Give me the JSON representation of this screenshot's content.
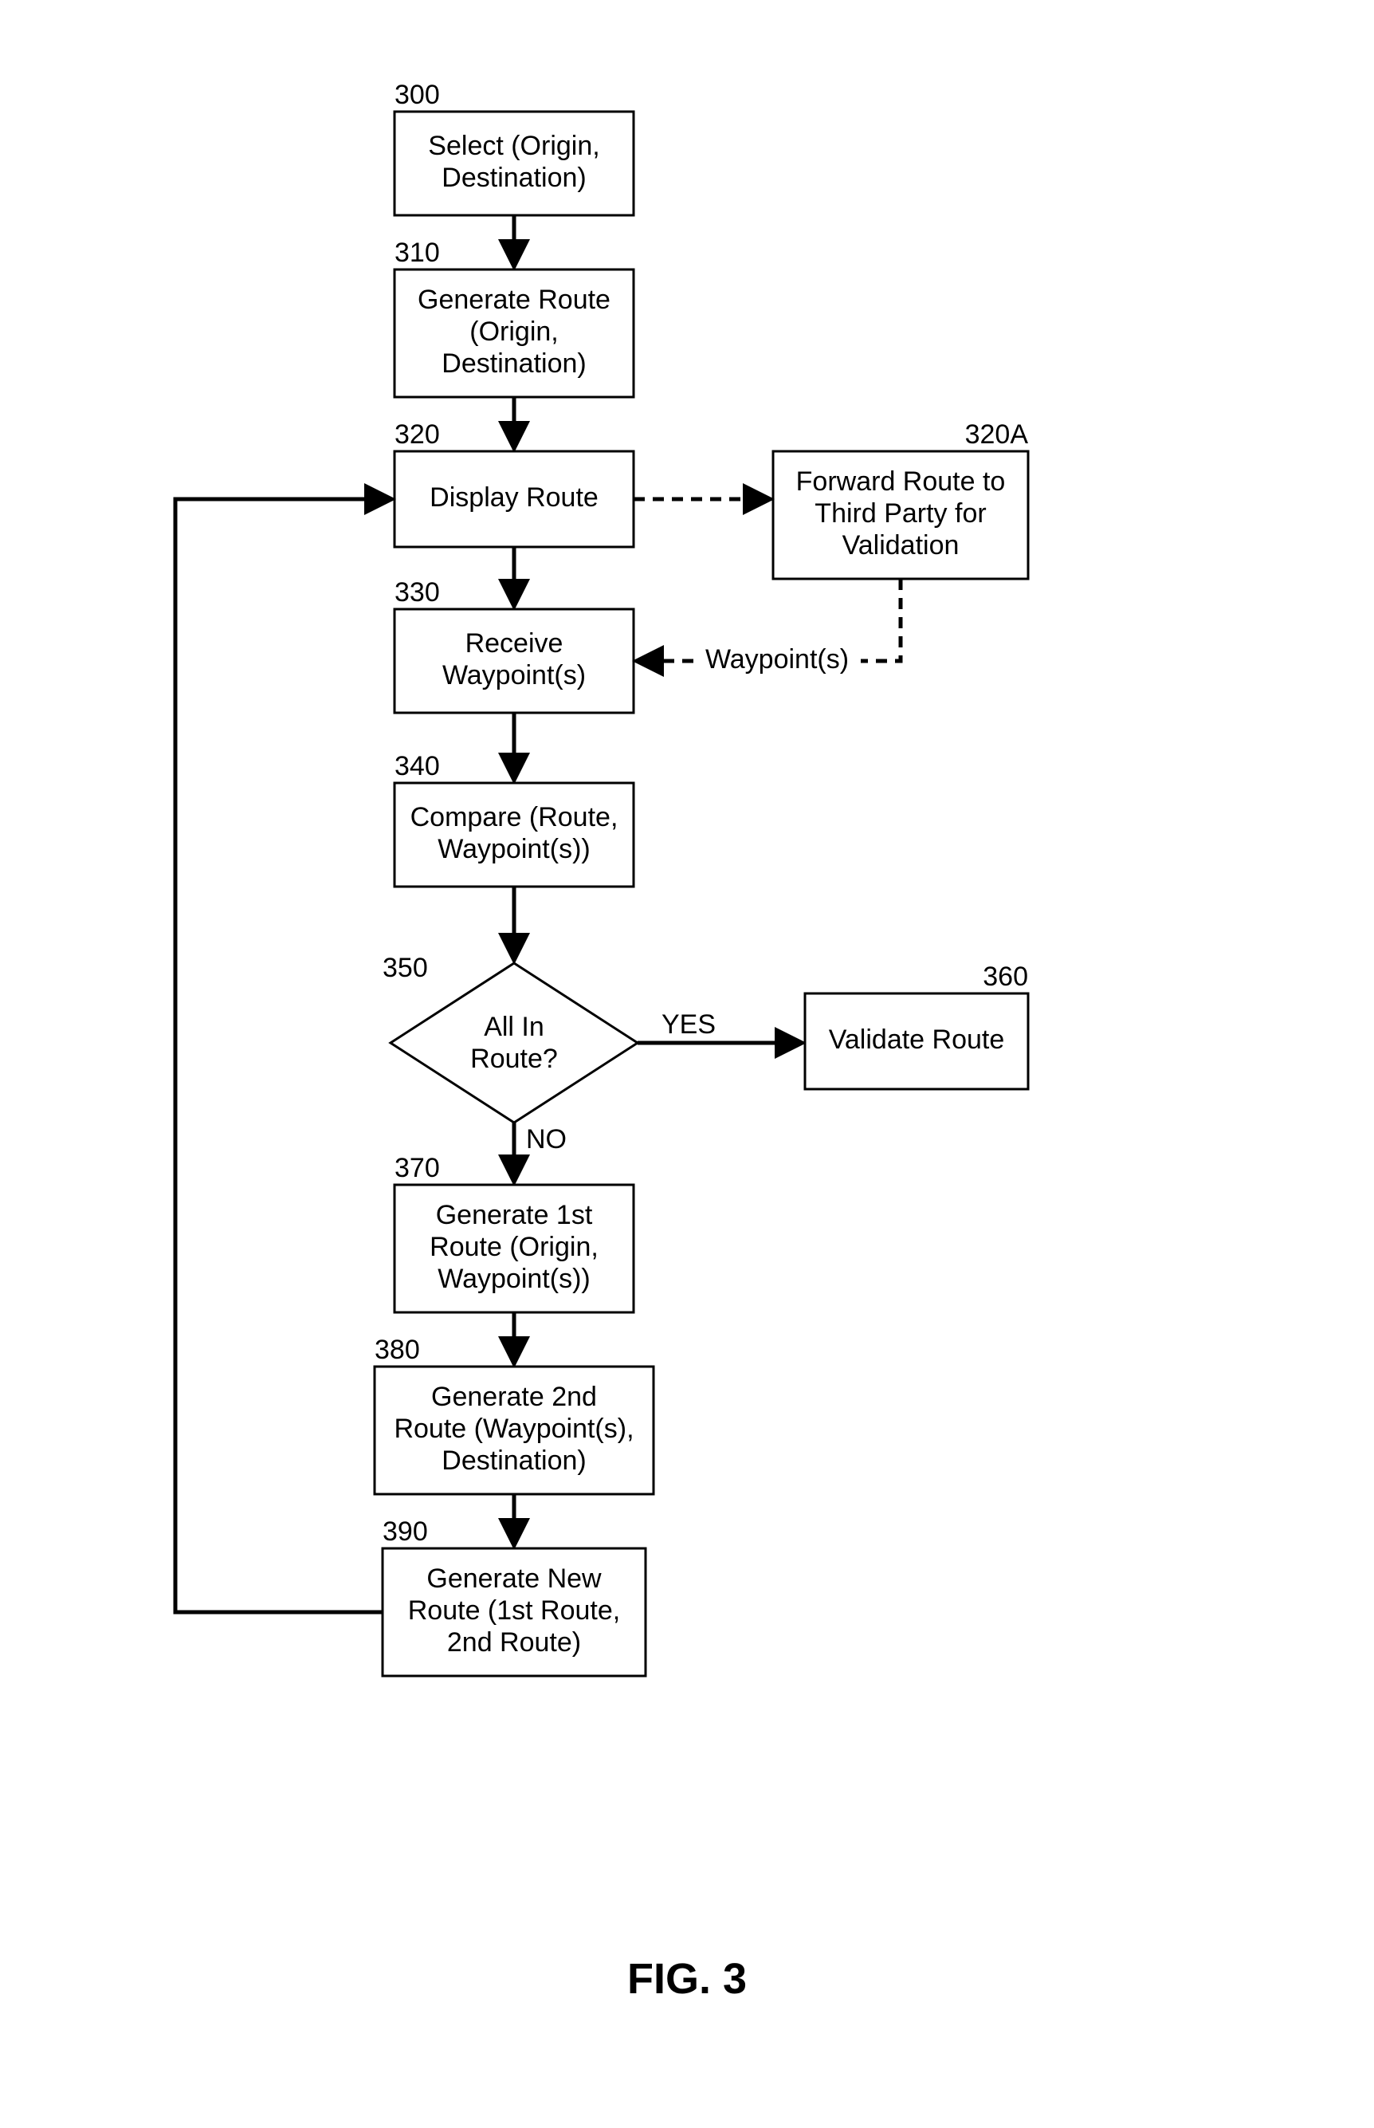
{
  "figure_label": "FIG. 3",
  "nodes": {
    "n300": {
      "num": "300",
      "l1": "Select (Origin,",
      "l2": "Destination)"
    },
    "n310": {
      "num": "310",
      "l1": "Generate Route",
      "l2": "(Origin,",
      "l3": "Destination)"
    },
    "n320": {
      "num": "320",
      "l1": "Display Route"
    },
    "n320A": {
      "num": "320A",
      "l1": "Forward Route to",
      "l2": "Third Party for",
      "l3": "Validation"
    },
    "n330": {
      "num": "330",
      "l1": "Receive",
      "l2": "Waypoint(s)"
    },
    "n340": {
      "num": "340",
      "l1": "Compare (Route,",
      "l2": "Waypoint(s))"
    },
    "n350": {
      "num": "350",
      "l1": "All In",
      "l2": "Route?"
    },
    "n360": {
      "num": "360",
      "l1": "Validate Route"
    },
    "n370": {
      "num": "370",
      "l1": "Generate 1st",
      "l2": "Route (Origin,",
      "l3": "Waypoint(s))"
    },
    "n380": {
      "num": "380",
      "l1": "Generate 2nd",
      "l2": "Route (Waypoint(s),",
      "l3": "Destination)"
    },
    "n390": {
      "num": "390",
      "l1": "Generate New",
      "l2": "Route (1st Route,",
      "l3": "2nd Route)"
    }
  },
  "edge_labels": {
    "yes": "YES",
    "no": "NO",
    "waypoints": "Waypoint(s)"
  }
}
